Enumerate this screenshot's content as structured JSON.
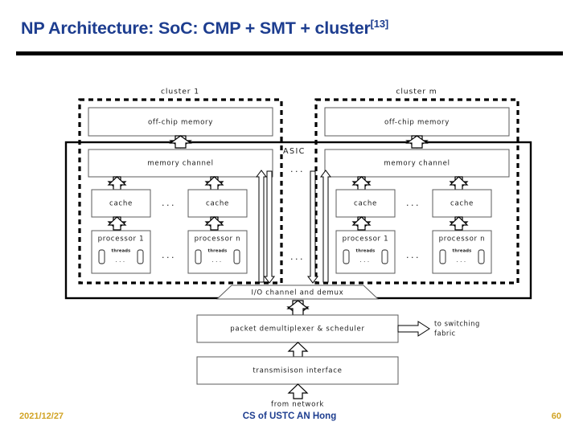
{
  "slide": {
    "title_main": "NP Architecture: SoC: CMP + SMT + cluster",
    "title_ref": "[13]"
  },
  "diagram": {
    "asic_label": "ASIC",
    "asic_ellipsis": "...",
    "cluster_ellipsis": "...",
    "clusters": [
      {
        "name": "cluster 1",
        "off_chip_memory": "off-chip memory",
        "memory_channel": "memory channel",
        "cache_left": "cache",
        "cache_right": "cache",
        "cache_ellipsis": "...",
        "processor_left": "processor 1",
        "processor_right": "processor n",
        "processor_ellipsis": "...",
        "threads_label_left": "threads",
        "threads_label_right": "threads",
        "threads_ellipsis_left": "...",
        "threads_ellipsis_right": "..."
      },
      {
        "name": "cluster m",
        "off_chip_memory": "off-chip memory",
        "memory_channel": "memory channel",
        "cache_left": "cache",
        "cache_right": "cache",
        "cache_ellipsis": "...",
        "processor_left": "processor 1",
        "processor_right": "processor n",
        "processor_ellipsis": "...",
        "threads_label_left": "threads",
        "threads_label_right": "threads",
        "threads_ellipsis_left": "...",
        "threads_ellipsis_right": "..."
      }
    ],
    "io_channel": "I/O channel and demux",
    "packet_demux": "packet demultiplexer & scheduler",
    "transmission_interface": "transmisison interface",
    "to_switching_fabric_line1": "to switching",
    "to_switching_fabric_line2": "fabric",
    "from_network": "from network"
  },
  "footer": {
    "date": "2021/12/27",
    "center": "CS of USTC AN Hong",
    "page": "60"
  },
  "colors": {
    "title": "#1d3d8f",
    "footer_accent": "#d1a324",
    "rule": "#000000"
  }
}
